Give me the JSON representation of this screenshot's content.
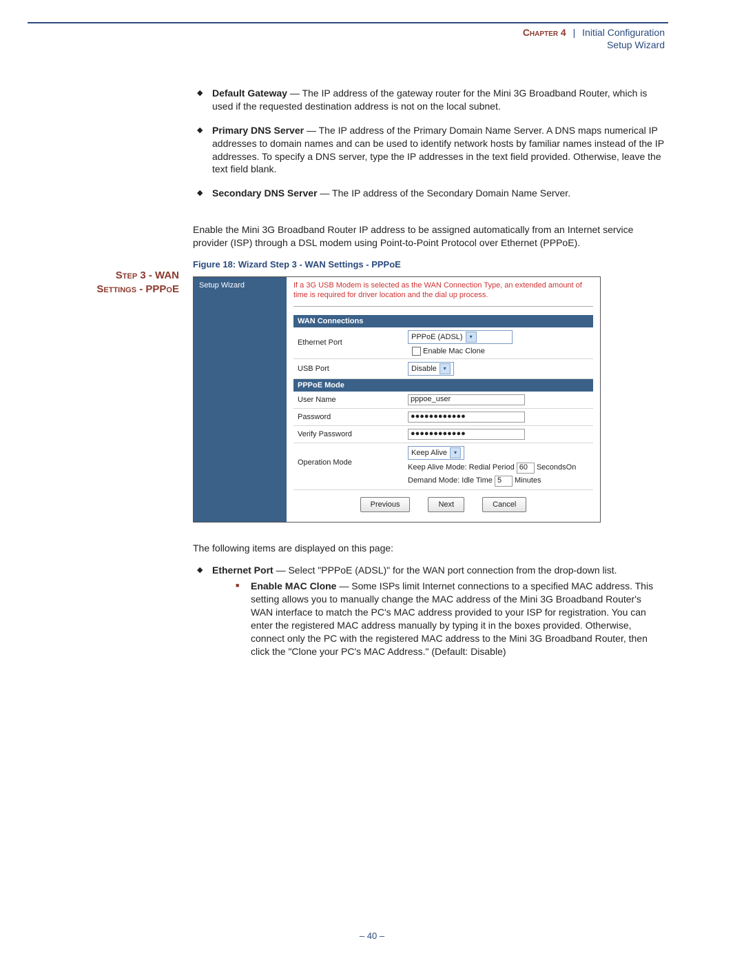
{
  "header": {
    "chapter": "Chapter 4",
    "pipe": "|",
    "title": "Initial Configuration",
    "subtitle": "Setup Wizard"
  },
  "bullets_top": [
    {
      "term": "Default Gateway",
      "text": " — The IP address of the gateway router for the Mini 3G Broadband Router, which is used if the requested destination address is not on the local subnet."
    },
    {
      "term": "Primary DNS Server",
      "text": " — The IP address of the Primary Domain Name Server. A DNS maps numerical IP addresses to domain names and can be used to identify network hosts by familiar names instead of the IP addresses. To specify a DNS server, type the IP addresses in the text field provided. Otherwise, leave the text field blank."
    },
    {
      "term": "Secondary DNS Server",
      "text": " — The IP address of the Secondary Domain Name Server."
    }
  ],
  "side_heading": {
    "line1": "Step 3 - WAN",
    "line2": "Settings - PPPoE"
  },
  "step_para": "Enable the Mini 3G Broadband Router IP address to be assigned automatically from an Internet service provider (ISP) through a DSL modem using Point-to-Point Protocol over Ethernet (PPPoE).",
  "figure_caption": "Figure 18:  Wizard Step 3 - WAN Settings - PPPoE",
  "figure": {
    "side_label": "Setup Wizard",
    "note": "If a 3G USB Modem is selected as the WAN Connection Type, an extended amount of time is required for driver location and the dial up process.",
    "section1": "WAN Connections",
    "eth_label": "Ethernet Port",
    "eth_value": "PPPoE (ADSL)",
    "eth_checkbox": "Enable Mac Clone",
    "usb_label": "USB Port",
    "usb_value": "Disable",
    "section2": "PPPoE Mode",
    "user_label": "User Name",
    "user_value": "pppoe_user",
    "pass_label": "Password",
    "pass_value": "●●●●●●●●●●●●",
    "vpass_label": "Verify Password",
    "vpass_value": "●●●●●●●●●●●●",
    "op_label": "Operation Mode",
    "op_value": "Keep Alive",
    "op_line1a": "Keep Alive Mode: Redial Period",
    "op_line1_val": "60",
    "op_line1b": "SecondsOn",
    "op_line2a": "Demand Mode: Idle Time",
    "op_line2_val": "5",
    "op_line2b": "Minutes",
    "btn_prev": "Previous",
    "btn_next": "Next",
    "btn_cancel": "Cancel"
  },
  "after_fig_para": "The following items are displayed on this page:",
  "bullets_bottom": [
    {
      "term": "Ethernet Port",
      "text": " — Select \"PPPoE (ADSL)\" for the WAN port connection from the drop-down list.",
      "sub": {
        "term": "Enable MAC Clone",
        "text": " — Some ISPs limit Internet connections to a specified MAC address. This setting allows you to manually change the MAC address of the Mini 3G Broadband Router's WAN interface to match the PC's MAC address provided to your ISP for registration. You can enter the registered MAC address manually by typing it in the boxes provided. Otherwise, connect only the PC with the registered MAC address to the Mini 3G Broadband Router, then click the \"Clone your PC's MAC Address.\" (Default: Disable)"
      }
    }
  ],
  "page_number": "–  40  –"
}
